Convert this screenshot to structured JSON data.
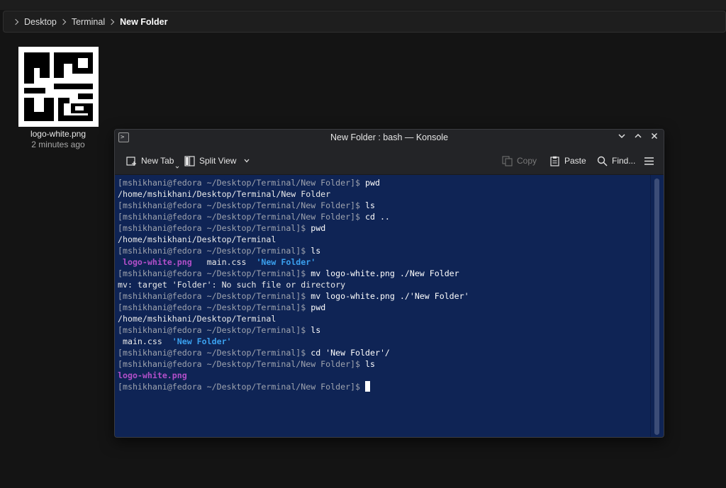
{
  "breadcrumb": {
    "items": [
      "Desktop",
      "Terminal",
      "New Folder"
    ]
  },
  "files": [
    {
      "name": "logo-white.png",
      "time": "2 minutes ago"
    }
  ],
  "konsole": {
    "title": "New Folder : bash — Konsole",
    "toolbar": {
      "new_tab": "New Tab",
      "split_view": "Split View",
      "copy": "Copy",
      "paste": "Paste",
      "find": "Find..."
    },
    "terminal_lines": [
      {
        "prompt": "[mshikhani@fedora ~/Desktop/Terminal/New Folder]$ ",
        "cmd": "pwd"
      },
      {
        "out": "/home/mshikhani/Desktop/Terminal/New Folder"
      },
      {
        "prompt": "[mshikhani@fedora ~/Desktop/Terminal/New Folder]$ ",
        "cmd": "ls"
      },
      {
        "prompt": "[mshikhani@fedora ~/Desktop/Terminal/New Folder]$ ",
        "cmd": "cd .."
      },
      {
        "prompt": "[mshikhani@fedora ~/Desktop/Terminal]$ ",
        "cmd": "pwd"
      },
      {
        "out": "/home/mshikhani/Desktop/Terminal"
      },
      {
        "prompt": "[mshikhani@fedora ~/Desktop/Terminal]$ ",
        "cmd": "ls"
      },
      {
        "ls": [
          {
            "text": " logo-white.png",
            "cls": "pink"
          },
          {
            "text": "   main.css  ",
            "cls": "out"
          },
          {
            "text": "'New Folder'",
            "cls": "blue"
          }
        ]
      },
      {
        "prompt": "[mshikhani@fedora ~/Desktop/Terminal]$ ",
        "cmd": "mv logo-white.png ./New Folder"
      },
      {
        "out": "mv: target 'Folder': No such file or directory"
      },
      {
        "prompt": "[mshikhani@fedora ~/Desktop/Terminal]$ ",
        "cmd": "mv logo-white.png ./'New Folder'"
      },
      {
        "prompt": "[mshikhani@fedora ~/Desktop/Terminal]$ ",
        "cmd": "pwd"
      },
      {
        "out": "/home/mshikhani/Desktop/Terminal"
      },
      {
        "prompt": "[mshikhani@fedora ~/Desktop/Terminal]$ ",
        "cmd": "ls"
      },
      {
        "ls": [
          {
            "text": " main.css  ",
            "cls": "out"
          },
          {
            "text": "'New Folder'",
            "cls": "blue"
          }
        ]
      },
      {
        "prompt": "[mshikhani@fedora ~/Desktop/Terminal]$ ",
        "cmd": "cd 'New Folder'/"
      },
      {
        "prompt": "[mshikhani@fedora ~/Desktop/Terminal/New Folder]$ ",
        "cmd": "ls"
      },
      {
        "ls": [
          {
            "text": "logo-white.png",
            "cls": "pink"
          }
        ]
      },
      {
        "prompt": "[mshikhani@fedora ~/Desktop/Terminal/New Folder]$ ",
        "cmd": "",
        "cursor": true
      }
    ]
  },
  "colors": {
    "terminal_bg": "#0f2455",
    "prompt": "#9ea3ae",
    "image_file": "#b24fc9",
    "directory": "#3aa0ee"
  }
}
